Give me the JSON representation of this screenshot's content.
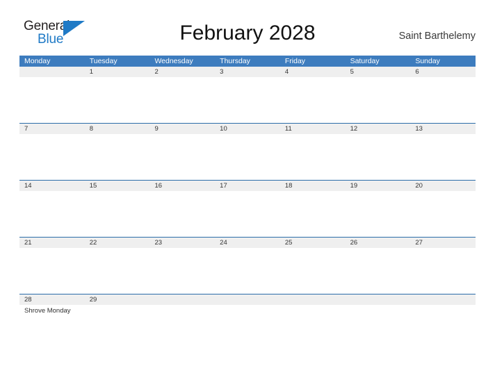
{
  "brand": {
    "name_top": "General",
    "name_bottom": "Blue",
    "accent_color": "#1f7ac6"
  },
  "header": {
    "title": "February 2028",
    "region": "Saint Barthelemy"
  },
  "calendar": {
    "header_bg": "#3d7cbe",
    "band_bg": "#efefef",
    "rule_color": "#2a6ca8",
    "weekday_headers": [
      "Monday",
      "Tuesday",
      "Wednesday",
      "Thursday",
      "Friday",
      "Saturday",
      "Sunday"
    ],
    "weeks": [
      {
        "days": [
          {
            "num": "",
            "events": []
          },
          {
            "num": "1",
            "events": []
          },
          {
            "num": "2",
            "events": []
          },
          {
            "num": "3",
            "events": []
          },
          {
            "num": "4",
            "events": []
          },
          {
            "num": "5",
            "events": []
          },
          {
            "num": "6",
            "events": []
          }
        ]
      },
      {
        "days": [
          {
            "num": "7",
            "events": []
          },
          {
            "num": "8",
            "events": []
          },
          {
            "num": "9",
            "events": []
          },
          {
            "num": "10",
            "events": []
          },
          {
            "num": "11",
            "events": []
          },
          {
            "num": "12",
            "events": []
          },
          {
            "num": "13",
            "events": []
          }
        ]
      },
      {
        "days": [
          {
            "num": "14",
            "events": []
          },
          {
            "num": "15",
            "events": []
          },
          {
            "num": "16",
            "events": []
          },
          {
            "num": "17",
            "events": []
          },
          {
            "num": "18",
            "events": []
          },
          {
            "num": "19",
            "events": []
          },
          {
            "num": "20",
            "events": []
          }
        ]
      },
      {
        "days": [
          {
            "num": "21",
            "events": []
          },
          {
            "num": "22",
            "events": []
          },
          {
            "num": "23",
            "events": []
          },
          {
            "num": "24",
            "events": []
          },
          {
            "num": "25",
            "events": []
          },
          {
            "num": "26",
            "events": []
          },
          {
            "num": "27",
            "events": []
          }
        ]
      },
      {
        "short": true,
        "days": [
          {
            "num": "28",
            "events": [
              "Shrove Monday"
            ]
          },
          {
            "num": "29",
            "events": []
          },
          {
            "num": "",
            "events": []
          },
          {
            "num": "",
            "events": []
          },
          {
            "num": "",
            "events": []
          },
          {
            "num": "",
            "events": []
          },
          {
            "num": "",
            "events": []
          }
        ]
      }
    ]
  }
}
